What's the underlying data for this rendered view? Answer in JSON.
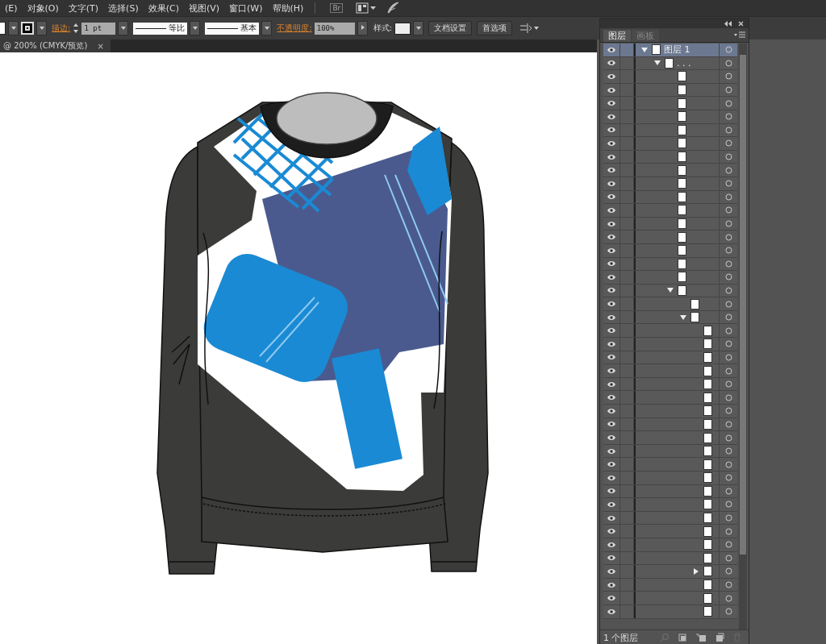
{
  "menu_bar": {
    "items": [
      "(E)",
      "对象(O)",
      "文字(T)",
      "选择(S)",
      "效果(C)",
      "视图(V)",
      "窗口(W)",
      "帮助(H)"
    ],
    "br_label": "Br"
  },
  "control_bar": {
    "stroke_label": "描边:",
    "stroke_weight": "1 pt",
    "profile": "等比",
    "brush": "基本",
    "opacity_label": "不透明度:",
    "opacity": "100%",
    "style_label": "样式:",
    "buttons": [
      "文档设置",
      "首选项"
    ]
  },
  "document_tab": {
    "title": "@ 200% (CMYK/预览)",
    "close": "×"
  },
  "layers_panel": {
    "tabs": [
      {
        "label": "图层",
        "selected": true
      },
      {
        "label": "画板",
        "selected": false
      }
    ],
    "layers": [
      {
        "kind": "layer",
        "name": "图层 1",
        "expanded": true,
        "selected": true,
        "children": [
          {
            "kind": "group",
            "name": ". . .",
            "expanded": true,
            "selected": false,
            "children": [
              {
                "kind": "path",
                "selected": false
              },
              {
                "kind": "path",
                "selected": false
              },
              {
                "kind": "path",
                "selected": false
              },
              {
                "kind": "path",
                "selected": false
              },
              {
                "kind": "path",
                "selected": false
              },
              {
                "kind": "path",
                "selected": false
              },
              {
                "kind": "path",
                "selected": false
              },
              {
                "kind": "path",
                "selected": false
              },
              {
                "kind": "path",
                "selected": false
              },
              {
                "kind": "path",
                "selected": false
              },
              {
                "kind": "path",
                "selected": false
              },
              {
                "kind": "path",
                "selected": false
              },
              {
                "kind": "path",
                "selected": false
              },
              {
                "kind": "path",
                "selected": false
              },
              {
                "kind": "path",
                "selected": false
              },
              {
                "kind": "path",
                "selected": false
              },
              {
                "kind": "group",
                "expanded": true,
                "selected": false,
                "children": [
                  {
                    "kind": "path",
                    "selected": false
                  },
                  {
                    "kind": "group",
                    "expanded": true,
                    "selected": false,
                    "children": [
                      {
                        "kind": "path",
                        "selected": false
                      },
                      {
                        "kind": "path",
                        "selected": false
                      },
                      {
                        "kind": "path",
                        "selected": false
                      },
                      {
                        "kind": "path",
                        "selected": false
                      },
                      {
                        "kind": "path",
                        "selected": false
                      },
                      {
                        "kind": "path",
                        "selected": false
                      },
                      {
                        "kind": "path",
                        "selected": false
                      },
                      {
                        "kind": "path",
                        "selected": false
                      },
                      {
                        "kind": "path",
                        "selected": false
                      },
                      {
                        "kind": "path",
                        "selected": false
                      },
                      {
                        "kind": "path",
                        "selected": false
                      },
                      {
                        "kind": "path",
                        "selected": false
                      },
                      {
                        "kind": "path",
                        "selected": false
                      },
                      {
                        "kind": "path",
                        "selected": false
                      },
                      {
                        "kind": "path",
                        "selected": false
                      },
                      {
                        "kind": "path",
                        "selected": false
                      },
                      {
                        "kind": "path",
                        "selected": false
                      },
                      {
                        "kind": "path",
                        "selected": false
                      },
                      {
                        "kind": "group",
                        "expanded": false,
                        "selected": false
                      },
                      {
                        "kind": "path",
                        "selected": false
                      },
                      {
                        "kind": "path",
                        "selected": false
                      },
                      {
                        "kind": "path",
                        "selected": false
                      }
                    ]
                  }
                ]
              }
            ]
          }
        ]
      }
    ],
    "footer": "1 个图层"
  }
}
